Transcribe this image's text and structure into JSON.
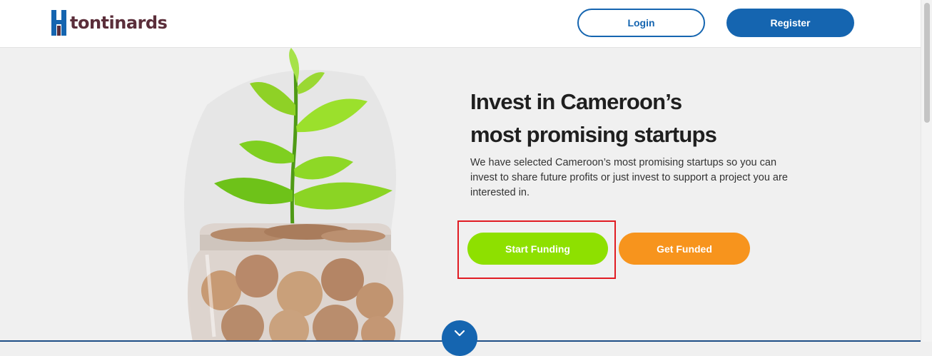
{
  "header": {
    "brand": "tontinards",
    "login_label": "Login",
    "register_label": "Register"
  },
  "hero": {
    "headline_line1": "Invest in Cameroon’s",
    "headline_line2": "most promising startups",
    "subtext": "We have selected Cameroon’s most promising startups so you can invest to share future profits or just invest to support a project you are interested in.",
    "start_funding_label": "Start Funding",
    "get_funded_label": "Get Funded",
    "image_icon": "plant-growing-from-coin-jar",
    "scroll_icon": "chevron-down-icon"
  },
  "colors": {
    "brand_blue": "#1565b0",
    "brand_text": "#5b2e3a",
    "start_funding": "#8ee000",
    "get_funded": "#f7941d",
    "highlight": "#e11b22"
  }
}
